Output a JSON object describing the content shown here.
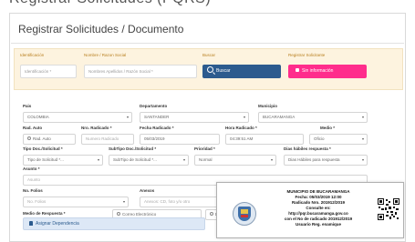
{
  "page": {
    "cut_header": "Registrar Solicitudes (PQRS)",
    "title": "Registrar Solicitudes / Documento"
  },
  "search_band": {
    "identificacion_label": "Identificación",
    "identificacion_placeholder": "Identificación *",
    "nombre_label": "Nombre / Razon Social",
    "nombre_placeholder": "Nombres Apellidos / Razón Social *",
    "buscar_label": "Buscar",
    "buscar_button": "Buscar",
    "registrar_label": "Registrar Solicitante",
    "registrar_button": "Sin información"
  },
  "form": {
    "pais_label": "Pais",
    "pais_value": "COLOMBIA",
    "departamento_label": "Departamento",
    "departamento_value": "SANTANDER",
    "municipio_label": "Municipio",
    "municipio_value": "BUCARAMANGA",
    "rad_auto_label": "Rad. Auto",
    "rad_auto_value": "Rad. Auto",
    "nro_radicado_label": "Nro. Radicado *",
    "nro_radicado_placeholder": "Numero Radicado",
    "fecha_radicado_label": "Fecha Radicado *",
    "fecha_radicado_value": "05/03/2019",
    "hora_radicado_label": "Hora Radicado *",
    "hora_radicado_value": "04:39:51 AM",
    "medio_label": "Medio *",
    "medio_value": "Oficio",
    "tipo_doc_label": "Tipo Doc./Solicitud *",
    "tipo_doc_value": "Tipo de Solicitud *...",
    "subtipo_label": "SubTipo Doc./Solicitud *",
    "subtipo_value": "SubTipo de Solicitud *...",
    "prioridad_label": "Prioridad *",
    "prioridad_value": "Normal",
    "dias_label": "Dias hábiles respuesta *",
    "dias_value": "Dias Hábiles para respuesta",
    "asunto_label": "Asunto *",
    "asunto_placeholder": "Asunto",
    "folios_label": "No. Folios",
    "folios_value": "No. Folios",
    "anexos_label": "Anexos",
    "anexos_placeholder": "Anexos: CD, foto y/o otro",
    "medio_respuesta_label": "Medio de Respuesta *",
    "correo_option": "Correo Electrónico",
    "other_option": "Dir."
  },
  "asignar_button": "Asignar Dependencia",
  "receipt": {
    "line1": "MUNICIPIO DE BUCARAMANGA",
    "line2": "Fecha: 05/03/2019 12:00",
    "line3": "Radicado Nro. 201912/2019",
    "line4": "Consulte en:",
    "line5": "http://pqr.bucaramanga.gov.co",
    "line6": "con el No de radicado 201912/2019",
    "line7": "Usuario Reg. enamique"
  },
  "icons": {
    "buscar": "search-icon",
    "registrar": "user-plus-icon",
    "asignar": "building-icon",
    "seal": "municipal-seal-icon",
    "qr": "qr-code-icon"
  },
  "colors": {
    "band_bg": "#fdf3df",
    "band_label": "#b87f1f",
    "buscar_btn": "#2c5b8e",
    "registrar_btn": "#ff2d8c",
    "asignar_bg": "#dde8f6"
  }
}
